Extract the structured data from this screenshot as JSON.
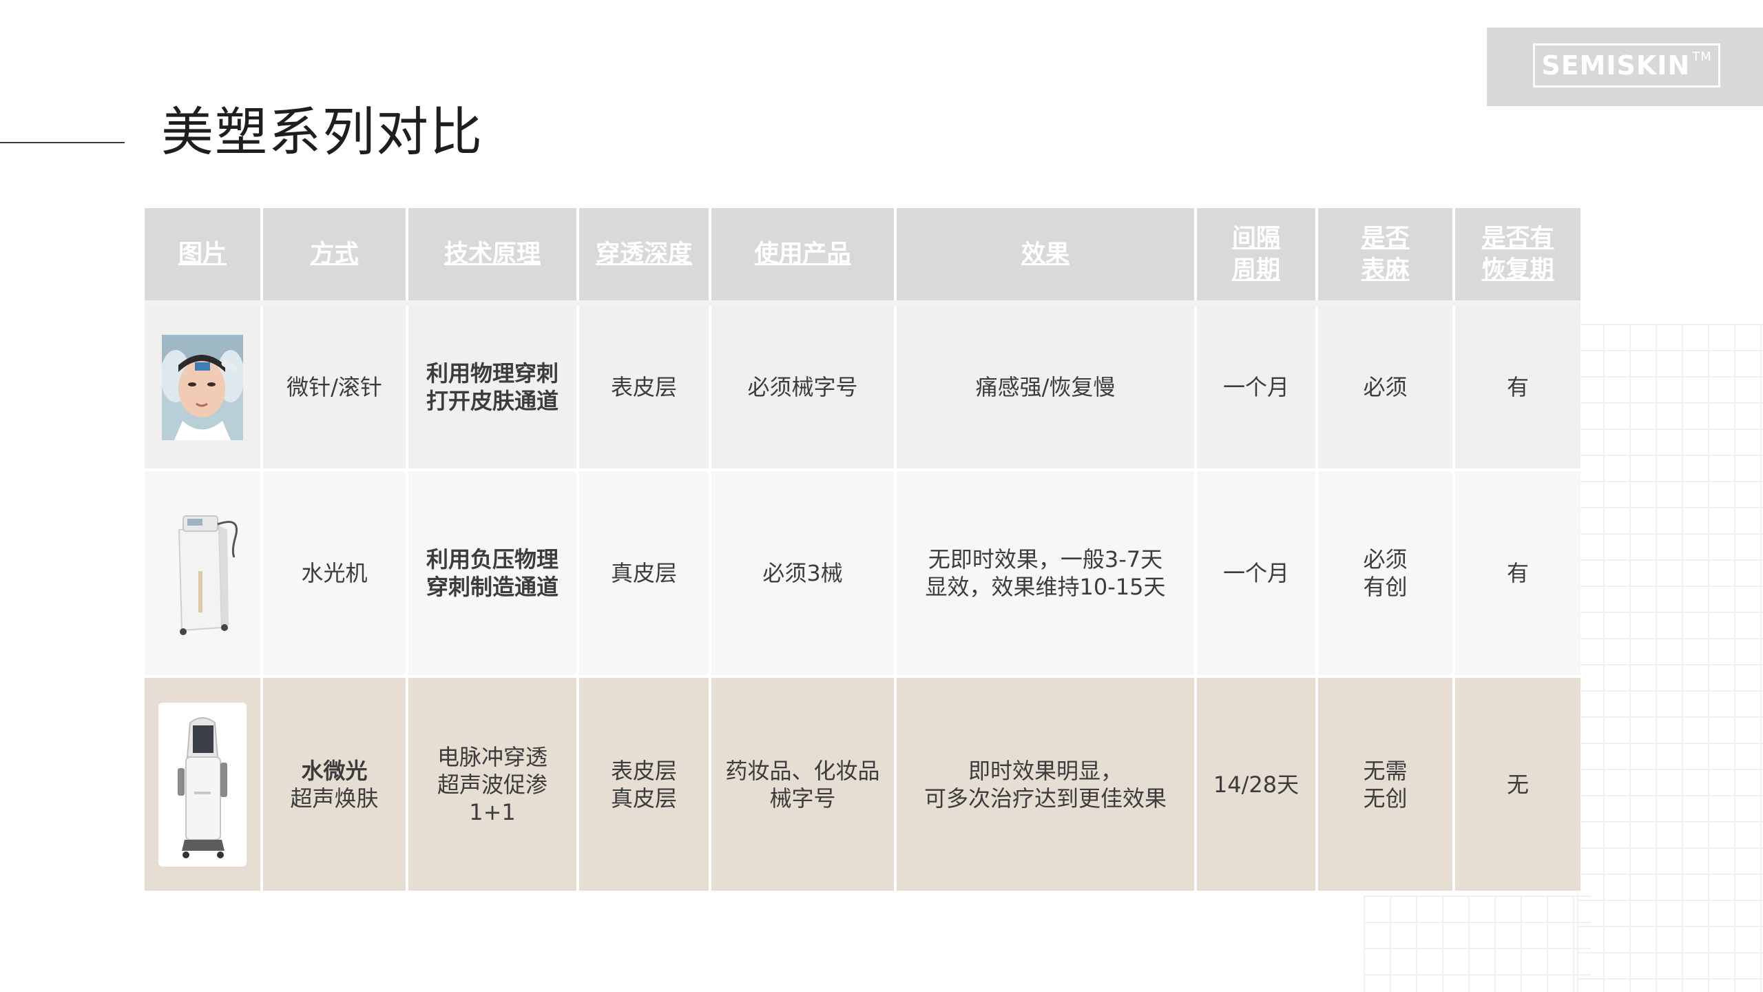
{
  "page": {
    "title": "美塑系列对比",
    "logo": {
      "text": "SEMISKIN",
      "tm": "TM"
    }
  },
  "table": {
    "headers": {
      "image": "图片",
      "method": "方式",
      "principle": "技术原理",
      "depth": "穿透深度",
      "product": "使用产品",
      "effect": "效果",
      "interval_l1": "间隔",
      "interval_l2": "周期",
      "anesthesia_l1": "是否",
      "anesthesia_l2": "表麻",
      "recovery_l1": "是否有",
      "recovery_l2": "恢复期"
    },
    "rows": [
      {
        "image_icon": "face-treatment-photo",
        "method": "微针/滚针",
        "principle_l1": "利用物理穿刺",
        "principle_l2": "打开皮肤通道",
        "depth": "表皮层",
        "product": "必须械字号",
        "effect": "痛感强/恢复慢",
        "interval": "一个月",
        "anesthesia": "必须",
        "recovery": "有"
      },
      {
        "image_icon": "hydro-injector-machine",
        "method": "水光机",
        "principle_l1": "利用负压物理",
        "principle_l2": "穿刺制造通道",
        "depth": "真皮层",
        "product": "必须3械",
        "effect_l1": "无即时效果，一般3-7天",
        "effect_l2": "显效，效果维持10-15天",
        "interval": "一个月",
        "anesthesia_l1": "必须",
        "anesthesia_l2": "有创",
        "recovery": "有"
      },
      {
        "image_icon": "ultrasonic-device",
        "method_l1": "水微光",
        "method_l2": "超声焕肤",
        "principle_l1": "电脉冲穿透",
        "principle_l2": "超声波促渗",
        "principle_l3": "1+1",
        "depth_l1": "表皮层",
        "depth_l2": "真皮层",
        "product_l1": "药妆品、化妆品",
        "product_l2": "械字号",
        "effect_l1": "即时效果明显，",
        "effect_l2": "可多次治疗达到更佳效果",
        "interval": "14/28天",
        "anesthesia_l1": "无需",
        "anesthesia_l2": "无创",
        "recovery": "无"
      }
    ]
  },
  "colors": {
    "header_bg": "#d9d9d9",
    "row1_bg": "#f0f0f0",
    "row2_bg": "#f7f7f7",
    "highlight_bg": "#e6ddd3",
    "logo_bg": "#d8d8d8"
  }
}
